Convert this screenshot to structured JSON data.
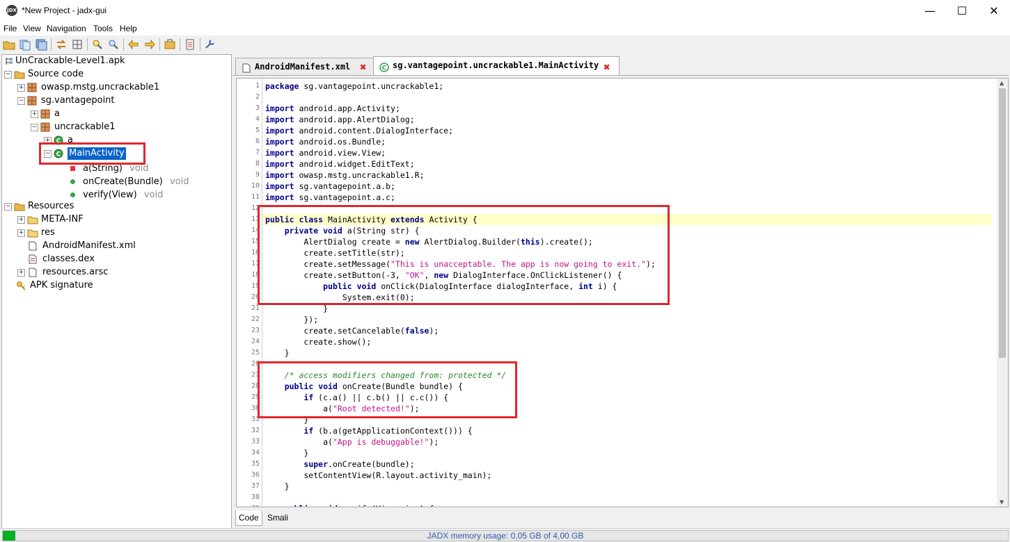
{
  "window": {
    "title": "*New Project - jadx-gui",
    "app_icon": "jadx-logo-icon"
  },
  "menu": [
    "File",
    "View",
    "Navigation",
    "Tools",
    "Help"
  ],
  "tree": {
    "root": "UnCrackable-Level1.apk",
    "source_code": "Source code",
    "pkg1": "owasp.mstg.uncrackable1",
    "pkg2": "sg.vantagepoint",
    "pkg2_a": "a",
    "pkg2_uncrackable1": "uncrackable1",
    "class_a": "a",
    "class_main": "MainActivity",
    "m1": "a(String)",
    "m1_ret": "void",
    "m2": "onCreate(Bundle)",
    "m2_ret": "void",
    "m3": "verify(View)",
    "m3_ret": "void",
    "resources": "Resources",
    "meta_inf": "META-INF",
    "res": "res",
    "manifest": "AndroidManifest.xml",
    "dex": "classes.dex",
    "arsc": "resources.arsc",
    "apk_sig": "APK signature"
  },
  "tabs": [
    {
      "label": "AndroidManifest.xml",
      "active": false
    },
    {
      "label": "sg.vantagepoint.uncrackable1.MainActivity",
      "active": true
    }
  ],
  "code": {
    "highlight_line": 13,
    "lines": [
      "package sg.vantagepoint.uncrackable1;",
      "",
      "import android.app.Activity;",
      "import android.app.AlertDialog;",
      "import android.content.DialogInterface;",
      "import android.os.Bundle;",
      "import android.view.View;",
      "import android.widget.EditText;",
      "import owasp.mstg.uncrackable1.R;",
      "import sg.vantagepoint.a.b;",
      "import sg.vantagepoint.a.c;",
      "",
      "public class MainActivity extends Activity {",
      "    private void a(String str) {",
      "        AlertDialog create = new AlertDialog.Builder(this).create();",
      "        create.setTitle(str);",
      "        create.setMessage(\"This is unacceptable. The app is now going to exit.\");",
      "        create.setButton(-3, \"OK\", new DialogInterface.OnClickListener() {",
      "            public void onClick(DialogInterface dialogInterface, int i) {",
      "                System.exit(0);",
      "            }",
      "        });",
      "        create.setCancelable(false);",
      "        create.show();",
      "    }",
      "",
      "    /* access modifiers changed from: protected */",
      "    public void onCreate(Bundle bundle) {",
      "        if (c.a() || c.b() || c.c()) {",
      "            a(\"Root detected!\");",
      "        }",
      "        if (b.a(getApplicationContext())) {",
      "            a(\"App is debuggable!\");",
      "        }",
      "        super.onCreate(bundle);",
      "        setContentView(R.layout.activity_main);",
      "    }",
      "",
      "    public void verify(View view) {"
    ]
  },
  "bottom_tabs": [
    "Code",
    "Smali"
  ],
  "status": {
    "memory": "JADX memory usage: 0,05 GB of 4,00 GB",
    "memory_fraction": 0.0125
  },
  "colors": {
    "keyword": "#00008b",
    "string": "#c2128c",
    "comment": "#2c8a2c",
    "highlight": "#ffffc8",
    "annotation_box": "#e0262a"
  }
}
